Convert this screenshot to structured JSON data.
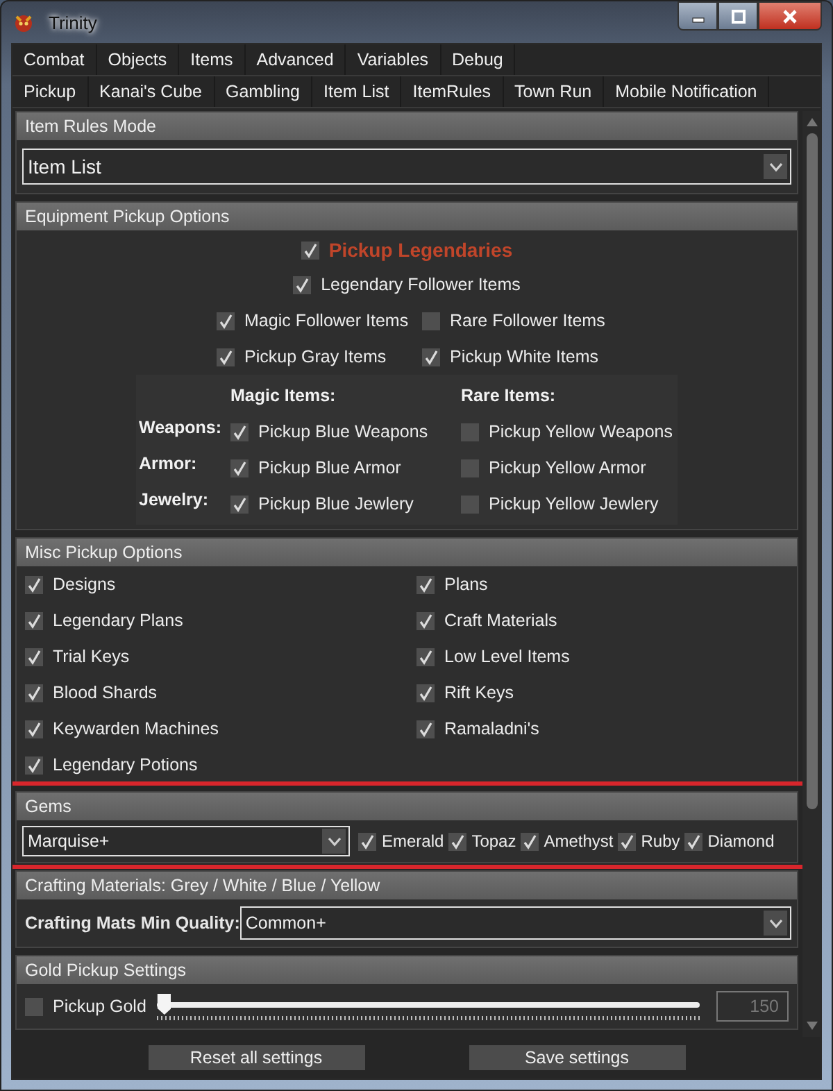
{
  "window": {
    "title": "Trinity"
  },
  "tab_rows": [
    [
      "Combat",
      "Objects",
      "Items",
      "Advanced",
      "Variables",
      "Debug"
    ],
    [
      "Pickup",
      "Kanai's Cube",
      "Gambling",
      "Item List",
      "ItemRules",
      "Town Run",
      "Mobile Notification"
    ]
  ],
  "sections": [
    {
      "kind": "combo",
      "title": "Item Rules Mode",
      "value": "Item List"
    },
    {
      "kind": "equipment",
      "title": "Equipment Pickup Options",
      "legendary": {
        "label": "Pickup Legendaries",
        "checked": true
      },
      "centered_rows": [
        [
          {
            "label": "Legendary Follower Items",
            "checked": true
          }
        ],
        [
          {
            "label": "Magic Follower Items",
            "checked": true
          },
          {
            "label": "Rare Follower Items",
            "checked": false
          }
        ],
        [
          {
            "label": "Pickup Gray Items",
            "checked": true
          },
          {
            "label": "Pickup White Items",
            "checked": true
          }
        ]
      ],
      "grid": {
        "headers": [
          "Magic Items:",
          "Rare Items:"
        ],
        "rows": [
          {
            "label": "Weapons:",
            "options": [
              {
                "label": "Pickup Blue Weapons",
                "checked": true
              },
              {
                "label": "Pickup Yellow Weapons",
                "checked": false
              }
            ]
          },
          {
            "label": "Armor:",
            "options": [
              {
                "label": "Pickup Blue Armor",
                "checked": true
              },
              {
                "label": "Pickup Yellow Armor",
                "checked": false
              }
            ]
          },
          {
            "label": "Jewelry:",
            "options": [
              {
                "label": "Pickup Blue Jewlery",
                "checked": true
              },
              {
                "label": "Pickup Yellow Jewlery",
                "checked": false
              }
            ]
          }
        ]
      }
    },
    {
      "kind": "checklist",
      "title": "Misc Pickup Options",
      "items": [
        {
          "label": "Designs",
          "checked": true
        },
        {
          "label": "Plans",
          "checked": true
        },
        {
          "label": "Legendary Plans",
          "checked": true
        },
        {
          "label": "Craft Materials",
          "checked": true
        },
        {
          "label": "Trial Keys",
          "checked": true
        },
        {
          "label": "Low Level Items",
          "checked": true
        },
        {
          "label": "Blood Shards",
          "checked": true
        },
        {
          "label": "Rift Keys",
          "checked": true
        },
        {
          "label": "Keywarden Machines",
          "checked": true
        },
        {
          "label": "Ramaladni's",
          "checked": true
        },
        {
          "label": "Legendary Potions",
          "checked": true
        }
      ]
    },
    {
      "kind": "gems",
      "title": "Gems",
      "highlighted": true,
      "value": "Marquise+",
      "items": [
        {
          "label": "Emerald",
          "checked": true
        },
        {
          "label": "Topaz",
          "checked": true
        },
        {
          "label": "Amethyst",
          "checked": true
        },
        {
          "label": "Ruby",
          "checked": true
        },
        {
          "label": "Diamond",
          "checked": true
        }
      ]
    },
    {
      "kind": "labeled_combo",
      "title": "Crafting Materials: Grey / White / Blue / Yellow",
      "label": "Crafting Mats Min Quality:",
      "value": "Common+"
    },
    {
      "kind": "slider",
      "title": "Gold Pickup Settings",
      "checkbox": {
        "label": "Pickup Gold",
        "checked": false
      },
      "level": 0,
      "reading": "150"
    }
  ],
  "buttons": [
    "Reset all settings",
    "Save settings"
  ]
}
